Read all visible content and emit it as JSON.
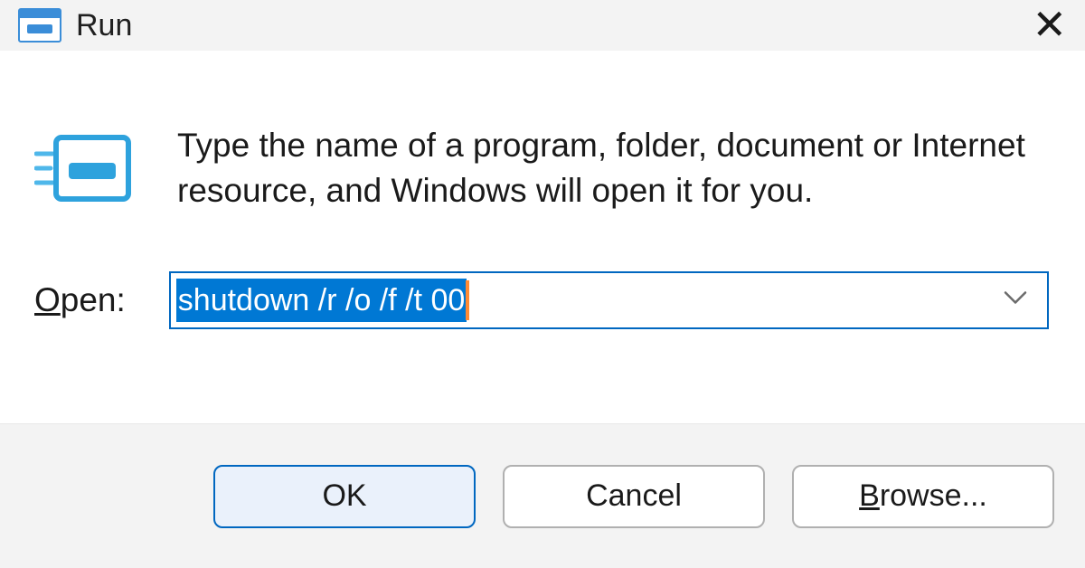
{
  "titlebar": {
    "title": "Run"
  },
  "body": {
    "instruction": "Type the name of a program, folder, document or Internet resource, and Windows will open it for you.",
    "open_label_prefix": "O",
    "open_label_rest": "pen:",
    "command_value": "shutdown /r /o /f /t 00"
  },
  "buttons": {
    "ok": "OK",
    "cancel": "Cancel",
    "browse_prefix": "B",
    "browse_rest": "rowse..."
  }
}
